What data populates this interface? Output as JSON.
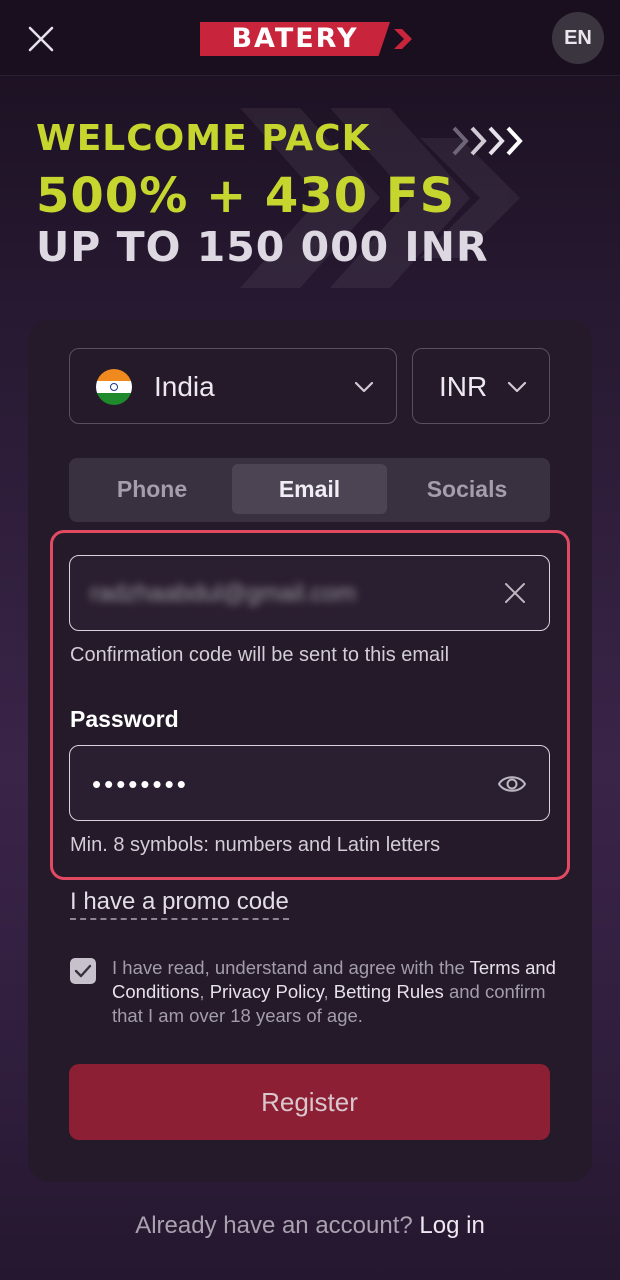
{
  "header": {
    "logo_text": "BATERY",
    "language": "EN"
  },
  "banner": {
    "line1": "WELCOME PACK",
    "line2": "500% + 430 FS",
    "line3": "UP TO 150 000 INR"
  },
  "form": {
    "country": "India",
    "currency": "INR",
    "tabs": [
      "Phone",
      "Email",
      "Socials"
    ],
    "active_tab": "Email",
    "email_value": "radzhaabdul@gmail.com",
    "email_hint": "Confirmation code will be sent to this email",
    "password_label": "Password",
    "password_value": "••••••••",
    "password_hint": "Min. 8 symbols: numbers and Latin letters",
    "promo_link": "I have a promo code",
    "agree_checked": true,
    "agree_prefix": "I have read, understand and agree with the",
    "terms": "Terms and Conditions",
    "privacy": "Privacy Policy",
    "betting_rules": "Betting Rules",
    "agree_suffix": "and confirm that I am over 18 years of age.",
    "register_label": "Register"
  },
  "footer": {
    "question": "Already have an account?",
    "login_label": "Log in"
  },
  "colors": {
    "brand_red": "#c8243b",
    "promo_green": "#c6d62e",
    "highlight": "#e24a63",
    "register_bg": "#8c1f33"
  }
}
